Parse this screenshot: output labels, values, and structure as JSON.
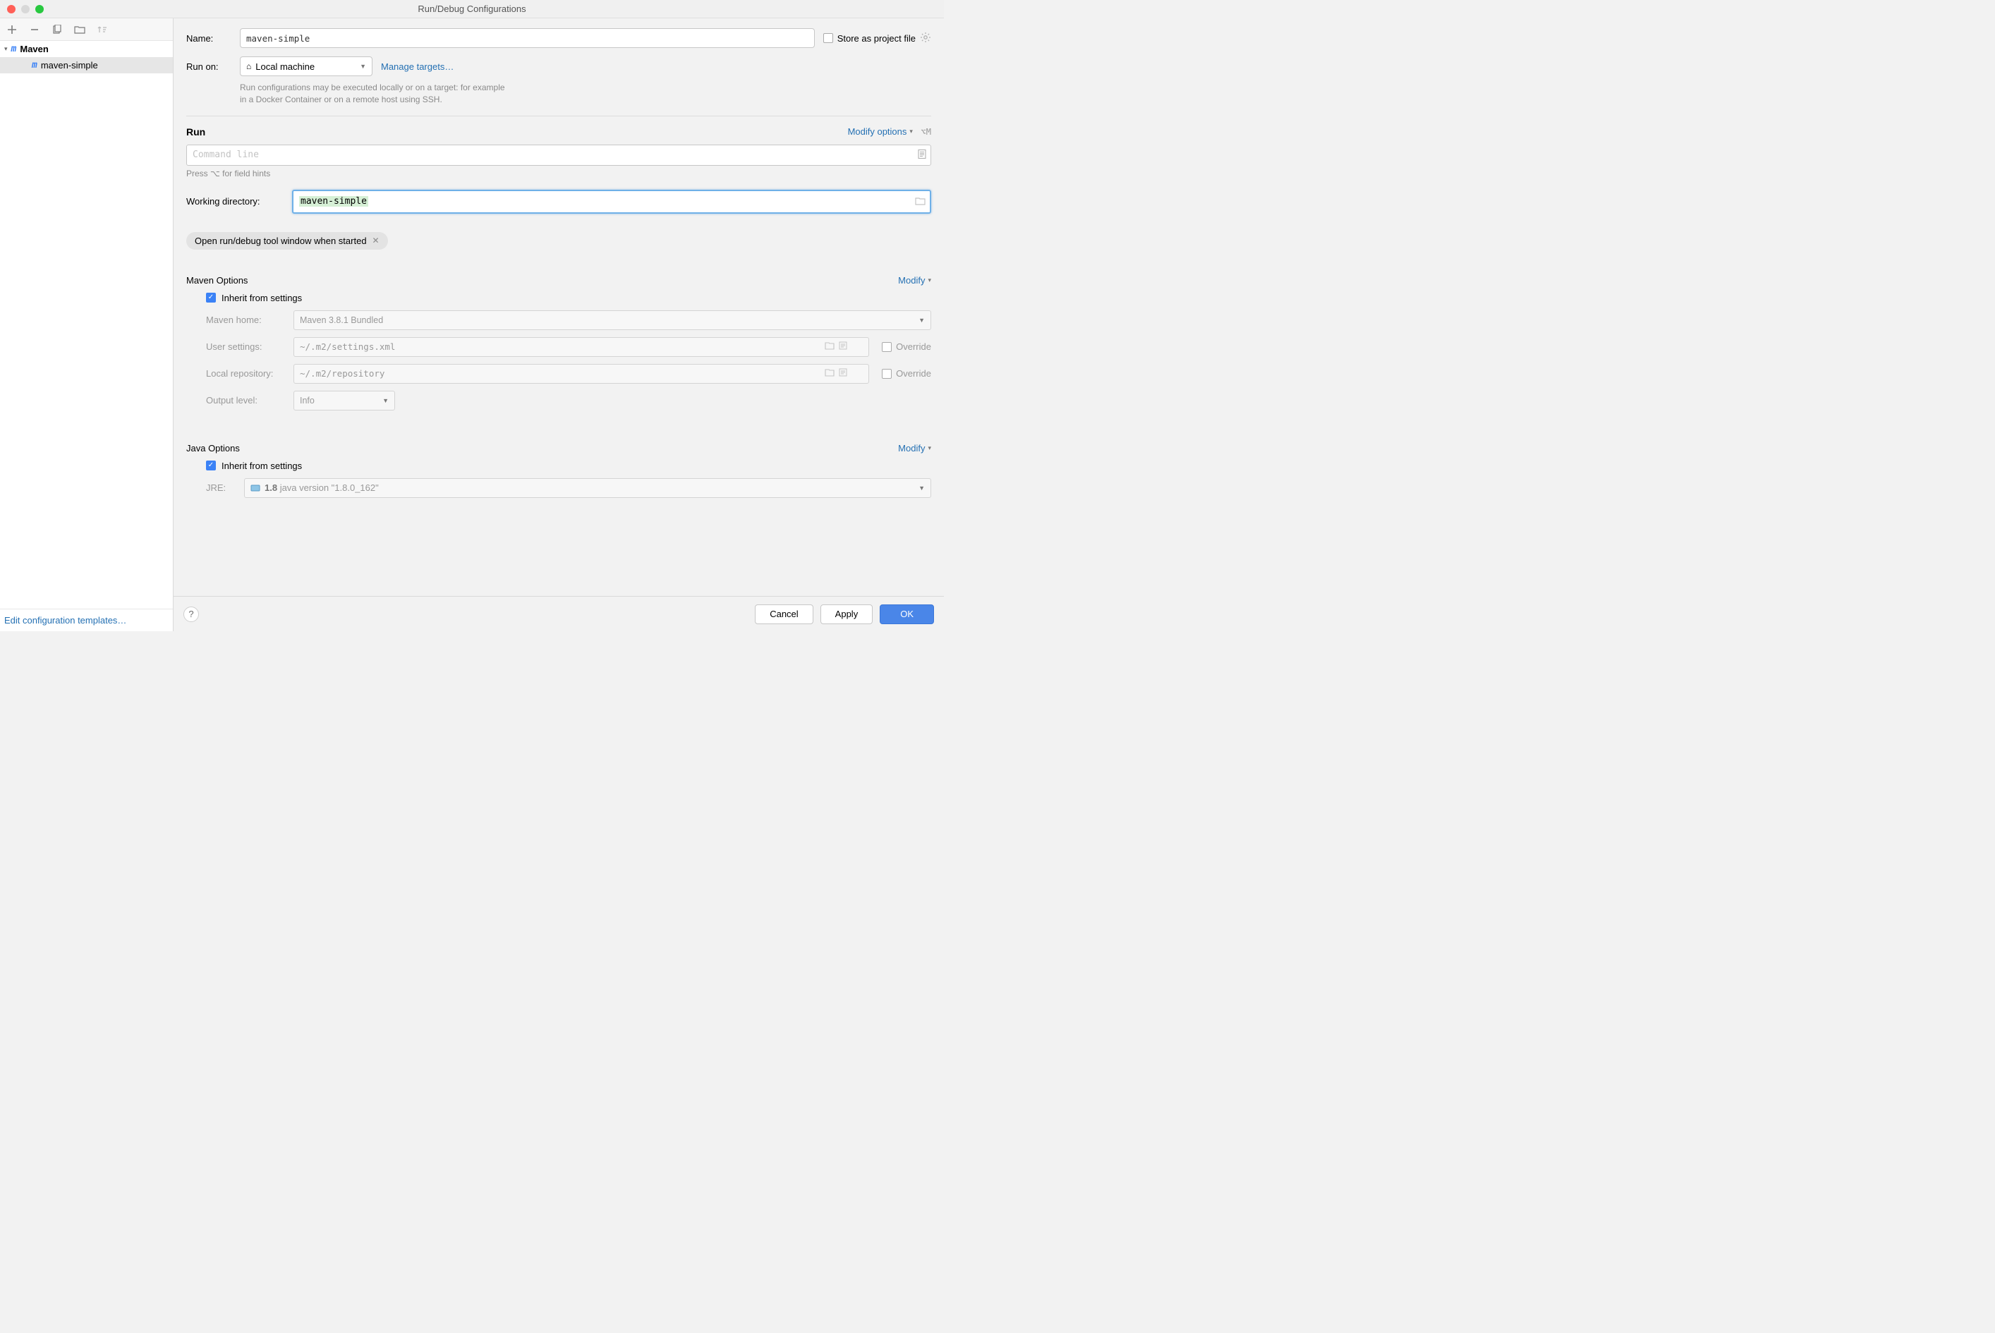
{
  "window": {
    "title": "Run/Debug Configurations"
  },
  "sidebar": {
    "root_label": "Maven",
    "item_label": "maven-simple",
    "footer_link": "Edit configuration templates…"
  },
  "form": {
    "name_label": "Name:",
    "name_value": "maven-simple",
    "store_label": "Store as project file",
    "run_on_label": "Run on:",
    "run_on_value": "Local machine",
    "manage_targets": "Manage targets…",
    "note_line1": "Run configurations may be executed locally or on a target: for example",
    "note_line2": "in a Docker Container or on a remote host using SSH.",
    "run_title": "Run",
    "modify_options": "Modify options",
    "modify_shortcut": "⌥M",
    "command_placeholder": "Command line",
    "hint": "Press ⌥ for field hints",
    "wd_label": "Working directory:",
    "wd_value": "maven-simple",
    "chip_label": "Open run/debug tool window when started",
    "maven_title": "Maven Options",
    "modify_link": "Modify",
    "inherit_label": "Inherit from settings",
    "maven_home_label": "Maven home:",
    "maven_home_value": "Maven 3.8.1 Bundled",
    "user_settings_label": "User settings:",
    "user_settings_value": "~/.m2/settings.xml",
    "local_repo_label": "Local repository:",
    "local_repo_value": "~/.m2/repository",
    "output_level_label": "Output level:",
    "output_level_value": "Info",
    "override_label": "Override",
    "java_title": "Java Options",
    "jre_label": "JRE:",
    "jre_value_bold": "1.8",
    "jre_value_rest": " java version \"1.8.0_162\""
  },
  "buttons": {
    "cancel": "Cancel",
    "apply": "Apply",
    "ok": "OK"
  }
}
